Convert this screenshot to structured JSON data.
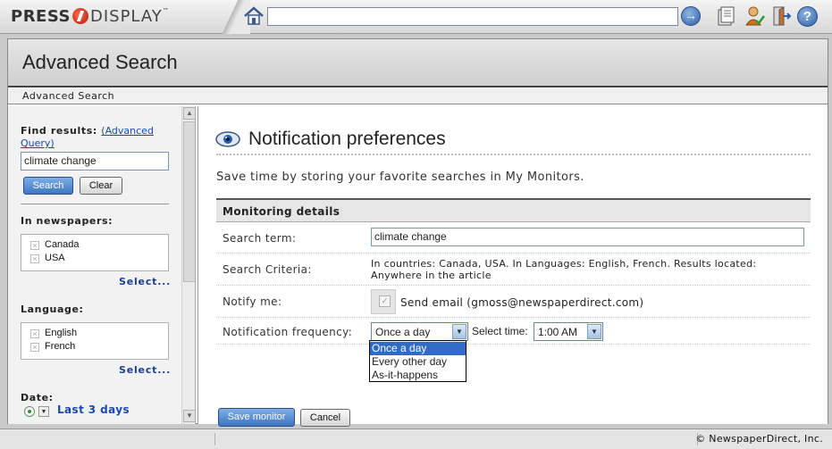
{
  "brand": {
    "logo_left": "PRESS",
    "logo_right": "DISPLAY",
    "tm": "™"
  },
  "topbar": {
    "search_value": "",
    "icons": [
      "home-icon",
      "go-arrow-icon",
      "newspaper-stack-icon",
      "user-check-icon",
      "exit-door-icon",
      "help-icon"
    ],
    "help_glyph": "?"
  },
  "page": {
    "title": "Advanced Search",
    "breadcrumb": "Advanced Search"
  },
  "sidebar": {
    "find_label": "Find results:",
    "advanced_link": "(Advanced Query)",
    "query_value": "climate change",
    "search_button": "Search",
    "clear_button": "Clear",
    "newspapers_label": "In newspapers:",
    "newspapers": [
      "Canada",
      "USA"
    ],
    "newspapers_select": "Select...",
    "language_label": "Language:",
    "languages": [
      "English",
      "French"
    ],
    "language_select": "Select...",
    "date_label": "Date:",
    "date_value": "Last 3 days"
  },
  "content": {
    "title": "Notification preferences",
    "description": "Save time by storing your favorite searches in My Monitors.",
    "section_header": "Monitoring details",
    "search_term_label": "Search term:",
    "search_term_value": "climate change",
    "criteria_label": "Search Criteria:",
    "criteria_text": "In countries: Canada, USA. In Languages: English, French. Results located: Anywhere in the article",
    "notify_label": "Notify me:",
    "notify_text": "Send email  (gmoss@newspaperdirect.com)",
    "frequency_label": "Notification frequency:",
    "frequency_value": "Once a day",
    "select_time_label": "Select time:",
    "time_value": "1:00 AM",
    "frequency_options": [
      "Once a day",
      "Every other day",
      "As-it-happens"
    ],
    "save_button": "Save monitor",
    "cancel_button": "Cancel"
  },
  "status": {
    "copyright": "© NewspaperDirect, Inc."
  }
}
